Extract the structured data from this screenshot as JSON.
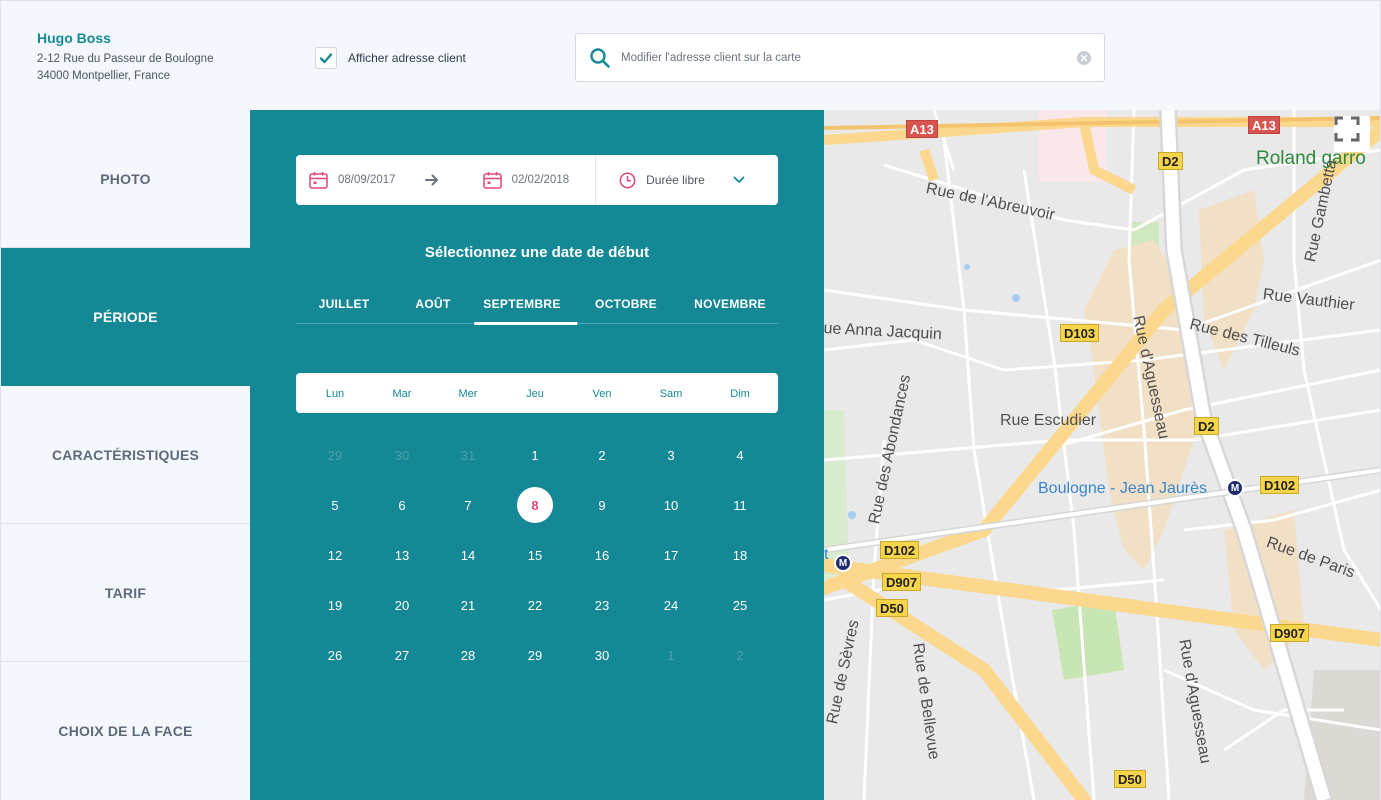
{
  "client": {
    "name": "Hugo Boss",
    "address_line1": "2-12 Rue du Passeur de Boulogne",
    "address_line2": "34000 Montpellier, France"
  },
  "show_address": {
    "label": "Afficher adresse client",
    "checked": true
  },
  "search": {
    "placeholder": "Modifier l'adresse client sur la carte"
  },
  "sidebar": {
    "items": [
      {
        "label": "PHOTO",
        "active": false
      },
      {
        "label": "PÉRIODE",
        "active": true
      },
      {
        "label": "CARACTÉRISTIQUES",
        "active": false
      },
      {
        "label": "TARIF",
        "active": false
      },
      {
        "label": "CHOIX DE LA FACE",
        "active": false
      }
    ]
  },
  "period": {
    "start_date": "08/09/2017",
    "end_date": "02/02/2018",
    "duration": "Durée libre",
    "title": "Sélectionnez une date de début",
    "months": [
      "JUILLET",
      "AOÛT",
      "SEPTEMBRE",
      "OCTOBRE",
      "NOVEMBRE"
    ],
    "active_month_index": 2,
    "weekdays": [
      "Lun",
      "Mar",
      "Mer",
      "Jeu",
      "Ven",
      "Sam",
      "Dim"
    ],
    "days": [
      [
        "29",
        "30",
        "31",
        "1",
        "2",
        "3",
        "4"
      ],
      [
        "5",
        "6",
        "7",
        "8",
        "9",
        "10",
        "11"
      ],
      [
        "12",
        "13",
        "14",
        "15",
        "16",
        "17",
        "18"
      ],
      [
        "19",
        "20",
        "21",
        "22",
        "23",
        "24",
        "25"
      ],
      [
        "26",
        "27",
        "28",
        "29",
        "30",
        "1",
        "2"
      ]
    ],
    "muted": [
      [
        0,
        0
      ],
      [
        0,
        1
      ],
      [
        0,
        2
      ],
      [
        4,
        5
      ],
      [
        4,
        6
      ]
    ],
    "selected": [
      1,
      3
    ]
  },
  "colors": {
    "teal": "#158895",
    "accent_pink": "#e0457b"
  },
  "map": {
    "labels": {
      "roland": "Roland garro",
      "abreuvoir": "Rue de l'Abreuvoir",
      "gambetta": "Rue Gambetta",
      "vauthier": "Rue Vauthier",
      "anna": "ue Anna Jacquin",
      "tilleuls": "Rue des Tilleuls",
      "aguesseau1": "Rue d'Aguesseau",
      "abondances": "Rue des Abondances",
      "escudier": "Rue Escudier",
      "boulogne": "Boulogne - Jean Jaurès",
      "paris": "Rue de Paris",
      "sevres": "Rue de Sèvres",
      "bellevue": "Rue de Bellevue",
      "aguesseau2": "Rue d'Aguesseau",
      "station_fragment": "t"
    },
    "badges": {
      "a13_left": "A13",
      "a13_right": "A13",
      "d2_top": "D2",
      "d103": "D103",
      "d2_mid": "D2",
      "d102_right": "D102",
      "d102_left": "D102",
      "d907_left": "D907",
      "d50_top": "D50",
      "d907_right": "D907",
      "d50_bottom": "D50"
    },
    "metro_symbol": "M"
  }
}
